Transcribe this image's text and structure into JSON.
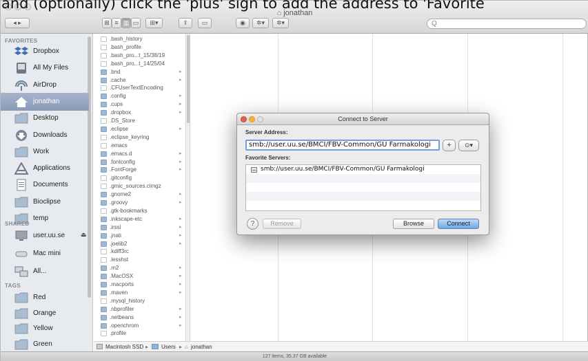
{
  "caption": "and (optionally) click the 'plus' sign to add the address to 'Favorite",
  "window": {
    "title": "jonathan"
  },
  "toolbar": {
    "back_forward": "◂ ▸",
    "view_icon": "⊞",
    "view_list": "≡",
    "view_column": "▥",
    "view_coverflow": "▭",
    "arrange": "⊞▾",
    "share": "⇪",
    "tags": "▭",
    "quicklook": "◉",
    "action": "✲▾",
    "dropbox": "✲▾",
    "search_placeholder": "Q"
  },
  "sidebar": {
    "favorites_header": "FAVORITES",
    "shared_header": "SHARED",
    "tags_header": "TAGS",
    "favorites": [
      {
        "label": "Dropbox",
        "icon": "dropbox-icon"
      },
      {
        "label": "All My Files",
        "icon": "all-files-icon"
      },
      {
        "label": "AirDrop",
        "icon": "airdrop-icon"
      },
      {
        "label": "jonathan",
        "icon": "home-icon",
        "selected": true
      },
      {
        "label": "Desktop",
        "icon": "folder-icon"
      },
      {
        "label": "Downloads",
        "icon": "downloads-icon"
      },
      {
        "label": "Work",
        "icon": "folder-icon"
      },
      {
        "label": "Applications",
        "icon": "applications-icon"
      },
      {
        "label": "Documents",
        "icon": "documents-icon"
      },
      {
        "label": "Bioclipse",
        "icon": "folder-icon"
      },
      {
        "label": "temp",
        "icon": "folder-icon"
      }
    ],
    "shared": [
      {
        "label": "user.uu.se",
        "icon": "server-icon",
        "eject": "⏏"
      },
      {
        "label": "Mac mini",
        "icon": "computer-icon"
      },
      {
        "label": "All...",
        "icon": "network-icon"
      }
    ],
    "tags": [
      {
        "label": "Red",
        "color": "#f2594f"
      },
      {
        "label": "Orange",
        "color": "#f7a738"
      },
      {
        "label": "Yellow",
        "color": "#f5d93a"
      },
      {
        "label": "Green",
        "color": "#6ec849"
      }
    ]
  },
  "files": [
    {
      "name": ".bash_history",
      "type": "doc"
    },
    {
      "name": ".bash_profile",
      "type": "doc"
    },
    {
      "name": ".bash_pro...t_15/38/19",
      "type": "doc"
    },
    {
      "name": ".bash_pro...t_14/25/04",
      "type": "doc"
    },
    {
      "name": ".bnd",
      "type": "folder",
      "arrow": "▸"
    },
    {
      "name": ".cache",
      "type": "folder",
      "arrow": "▸"
    },
    {
      "name": ".CFUserTextEncoding",
      "type": "doc"
    },
    {
      "name": ".config",
      "type": "folder",
      "arrow": "▸"
    },
    {
      "name": ".cups",
      "type": "folder",
      "arrow": "▸"
    },
    {
      "name": ".dropbox",
      "type": "folder",
      "arrow": "▸"
    },
    {
      "name": ".DS_Store",
      "type": "doc"
    },
    {
      "name": ".eclipse",
      "type": "folder",
      "arrow": "▸"
    },
    {
      "name": ".eclipse_keyring",
      "type": "doc"
    },
    {
      "name": ".emacs",
      "type": "doc"
    },
    {
      "name": ".emacs.d",
      "type": "folder",
      "arrow": "▸"
    },
    {
      "name": ".fontconfig",
      "type": "folder",
      "arrow": "▸"
    },
    {
      "name": ".FontForge",
      "type": "folder",
      "arrow": "▸"
    },
    {
      "name": ".gitconfig",
      "type": "doc"
    },
    {
      "name": ".gmic_sources.cimgz",
      "type": "doc"
    },
    {
      "name": ".gnome2",
      "type": "folder",
      "arrow": "▸"
    },
    {
      "name": ".groovy",
      "type": "folder",
      "arrow": "▸"
    },
    {
      "name": ".gtk-bookmarks",
      "type": "doc"
    },
    {
      "name": ".inkscape-etc",
      "type": "folder",
      "arrow": "▸"
    },
    {
      "name": ".irssi",
      "type": "folder",
      "arrow": "▸"
    },
    {
      "name": ".jnati",
      "type": "folder",
      "arrow": "▸"
    },
    {
      "name": ".joelib2",
      "type": "folder",
      "arrow": "▸"
    },
    {
      "name": ".kdiff3rc",
      "type": "doc"
    },
    {
      "name": ".lesshst",
      "type": "doc"
    },
    {
      "name": ".m2",
      "type": "folder",
      "arrow": "▸"
    },
    {
      "name": ".MacOSX",
      "type": "folder",
      "arrow": "▸"
    },
    {
      "name": ".macports",
      "type": "folder",
      "arrow": "▸"
    },
    {
      "name": ".maven",
      "type": "folder",
      "arrow": "▸"
    },
    {
      "name": ".mysql_history",
      "type": "doc"
    },
    {
      "name": ".nbprofiler",
      "type": "folder",
      "arrow": "▸"
    },
    {
      "name": ".netbeans",
      "type": "folder",
      "arrow": "▸"
    },
    {
      "name": ".openchrom",
      "type": "folder",
      "arrow": "▸"
    },
    {
      "name": ".profile",
      "type": "doc"
    }
  ],
  "pathbar": {
    "disk": "Macintosh SSD",
    "sep": "▸",
    "users": "Users",
    "home": "jonathan"
  },
  "status": "127 items, 35.37 GB available",
  "dialog": {
    "title": "Connect to Server",
    "server_address_label": "Server Address:",
    "server_address_value": "smb://user.uu.se/BMCI/FBV-Common/GU Farmakologi",
    "plus_label": "+",
    "recent_label": "⊙▾",
    "favorite_servers_label": "Favorite Servers:",
    "favorites": [
      "smb://user.uu.se/BMCI/FBV-Common/GU Farmakologi"
    ],
    "help_label": "?",
    "remove_label": "Remove",
    "browse_label": "Browse",
    "connect_label": "Connect"
  }
}
